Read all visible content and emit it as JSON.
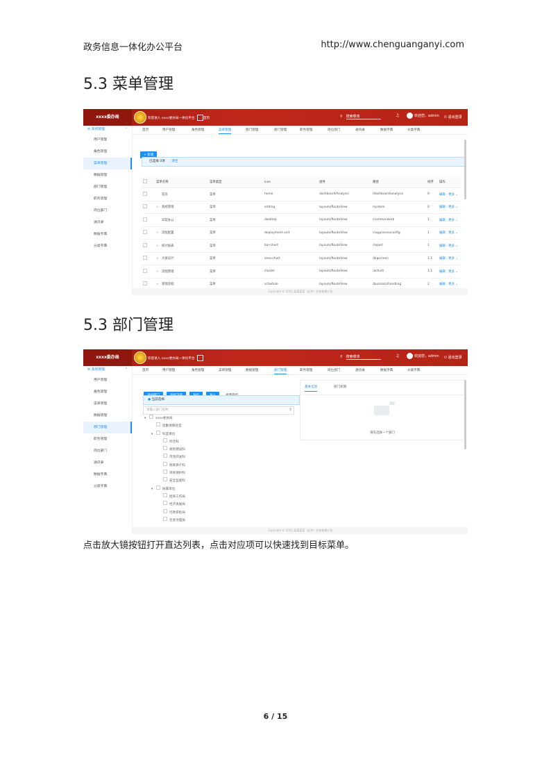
{
  "header": {
    "left": "政务信息一体化办公平台",
    "right": "http://www.chenguanganyi.com"
  },
  "sections": [
    {
      "title": "5.3 菜单管理"
    },
    {
      "title": "5.3 部门管理"
    }
  ],
  "app": {
    "brand": "xxxx委办局",
    "welcome": "欢迎进入 xxxx委办局一体化平台",
    "home": "首页",
    "search_placeholder": "搜索菜单",
    "user": "欢迎您，admin",
    "logout": "退出登录",
    "sidebar_head": "系统管理",
    "copyright": "Copyright © 2022 某某某某（北京）科技有限公司"
  },
  "shot1": {
    "sidebar": [
      "用户管理",
      "角色管理",
      "菜单管理",
      "数据管理",
      "部门管理",
      "职务管理",
      "岗位部门",
      "通讯录",
      "数据字典",
      "分类字典"
    ],
    "active_side": 2,
    "tabs": [
      "首页",
      "用户管理",
      "角色管理",
      "菜单管理",
      "部门管理",
      "部门管理",
      "职务管理",
      "岗位部门",
      "通讯录",
      "数据字典",
      "分类字典"
    ],
    "active_tab": 3,
    "add_button": "+ 新增",
    "selected": "已选择 0项",
    "clear": "清空",
    "columns": [
      "菜单名称",
      "菜单类型",
      "icon",
      "组件",
      "路径",
      "排序",
      "操作"
    ],
    "rows": [
      {
        "name": "首页",
        "expand": "",
        "type": "菜单",
        "icon": "home",
        "component": "dashboard/Analysis",
        "path": "/dashboard/analysis",
        "sort": "0"
      },
      {
        "name": "系统管理",
        "expand": "+",
        "type": "菜单",
        "icon": "setting",
        "component": "layouts/RouteView",
        "path": "/system",
        "sort": "0"
      },
      {
        "name": "日常办公",
        "expand": "",
        "type": "菜单",
        "icon": "desktop",
        "component": "layouts/RouteView",
        "path": "/commonwork",
        "sort": "1"
      },
      {
        "name": "流程配置",
        "expand": "+",
        "type": "菜单",
        "icon": "deployment-unit",
        "component": "layouts/RouteView",
        "path": "/capprocessconfig",
        "sort": "1"
      },
      {
        "name": "统计报表",
        "expand": "+",
        "type": "菜单",
        "icon": "bar-chart",
        "component": "layouts/RouteView",
        "path": "/report",
        "sort": "1"
      },
      {
        "name": "大屏设计",
        "expand": "+",
        "type": "菜单",
        "icon": "area-chart",
        "component": "layouts/RouteView",
        "path": "/bigscreen",
        "sort": "1.1"
      },
      {
        "name": "流程管理",
        "expand": "+",
        "type": "菜单",
        "icon": "cluster",
        "component": "layouts/RouteView",
        "path": "/activiti",
        "sort": "1.1"
      },
      {
        "name": "受理流程",
        "expand": "+",
        "type": "菜单",
        "icon": "schedule",
        "component": "layouts/RouteView",
        "path": "/business/handling",
        "sort": "2"
      },
      {
        "name": "业务办理",
        "expand": "+",
        "type": "菜单",
        "icon": "file-sync",
        "component": "layouts/RouteView",
        "path": "/businesshandling",
        "sort": "3"
      }
    ],
    "edit": "编辑",
    "more": "更多 ⌄"
  },
  "shot2": {
    "sidebar": [
      "用户管理",
      "角色管理",
      "菜单管理",
      "数据管理",
      "部门管理",
      "职务管理",
      "岗位部门",
      "通讯录",
      "数据字典",
      "分类字典"
    ],
    "active_side": 4,
    "tabs": [
      "首页",
      "用户管理",
      "角色管理",
      "菜单管理",
      "数据管理",
      "部门管理",
      "职务管理",
      "岗位部门",
      "通讯录",
      "数据字典",
      "分类字典"
    ],
    "active_tab": 5,
    "buttons": [
      "添加部门",
      "添加下级",
      "导出",
      "导入"
    ],
    "batch": "批量操作",
    "current_select": "当前选择:",
    "search_placeholder": "请输入部门名称",
    "right_tabs": [
      "基本信息",
      "部门权限"
    ],
    "empty_hint": "请先选择一个部门",
    "tree": [
      {
        "label": "xxxx委办局",
        "level": 0,
        "expand": "▾"
      },
      {
        "label": "后勤保障处室",
        "level": 1,
        "expand": ""
      },
      {
        "label": "科室单位",
        "level": 1,
        "expand": "▾"
      },
      {
        "label": "综合科",
        "level": 2,
        "expand": ""
      },
      {
        "label": "规划建设科",
        "level": 2,
        "expand": ""
      },
      {
        "label": "市场开发科",
        "level": 2,
        "expand": ""
      },
      {
        "label": "财政审计科",
        "level": 2,
        "expand": ""
      },
      {
        "label": "项目保护科",
        "level": 2,
        "expand": ""
      },
      {
        "label": "安全监督科",
        "level": 2,
        "expand": ""
      },
      {
        "label": "局属单位",
        "level": 1,
        "expand": "▾"
      },
      {
        "label": "招商工作局",
        "level": 2,
        "expand": ""
      },
      {
        "label": "经济发展局",
        "level": 2,
        "expand": ""
      },
      {
        "label": "行政审批局",
        "level": 2,
        "expand": ""
      },
      {
        "label": "社会治理局",
        "level": 2,
        "expand": ""
      }
    ]
  },
  "caption": "点击放大镜按钮打开直达列表，点击对应项可以快速找到目标菜单。",
  "page_number": "6 / 15"
}
